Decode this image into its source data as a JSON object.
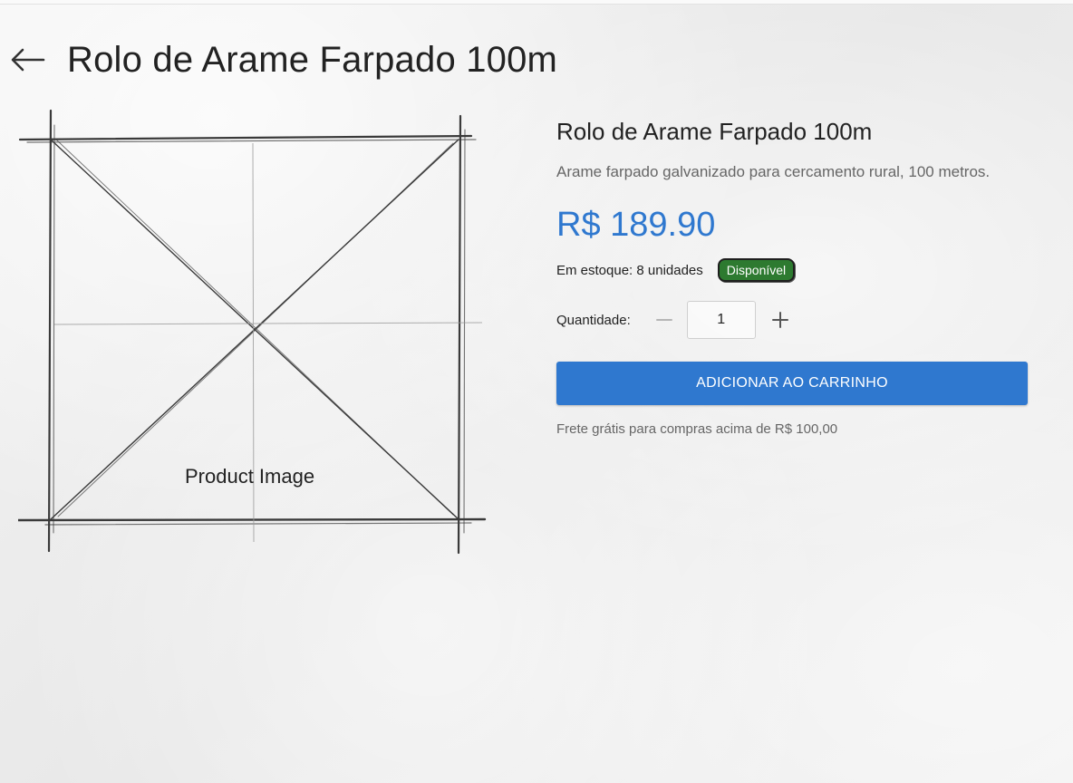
{
  "header": {
    "title": "Rolo de Arame Farpado 100m"
  },
  "image": {
    "label": "Product Image"
  },
  "product": {
    "name": "Rolo de Arame Farpado 100m",
    "description": "Arame farpado galvanizado para cercamento rural, 100 metros.",
    "price": "R$ 189.90",
    "stock_text": "Em estoque: 8 unidades",
    "availability_badge": "Disponível"
  },
  "quantity": {
    "label": "Quantidade:",
    "value": "1"
  },
  "actions": {
    "add_to_cart_label": "ADICIONAR AO CARRINHO"
  },
  "shipping": {
    "note": "Frete grátis para compras acima de R$ 100,00"
  },
  "icons": {
    "back": "arrow-left-icon",
    "decrement": "minus-icon",
    "increment": "plus-icon"
  },
  "colors": {
    "accent": "#2f78cf",
    "badge": "#2d7a30",
    "text": "#222222",
    "muted": "#666666"
  }
}
